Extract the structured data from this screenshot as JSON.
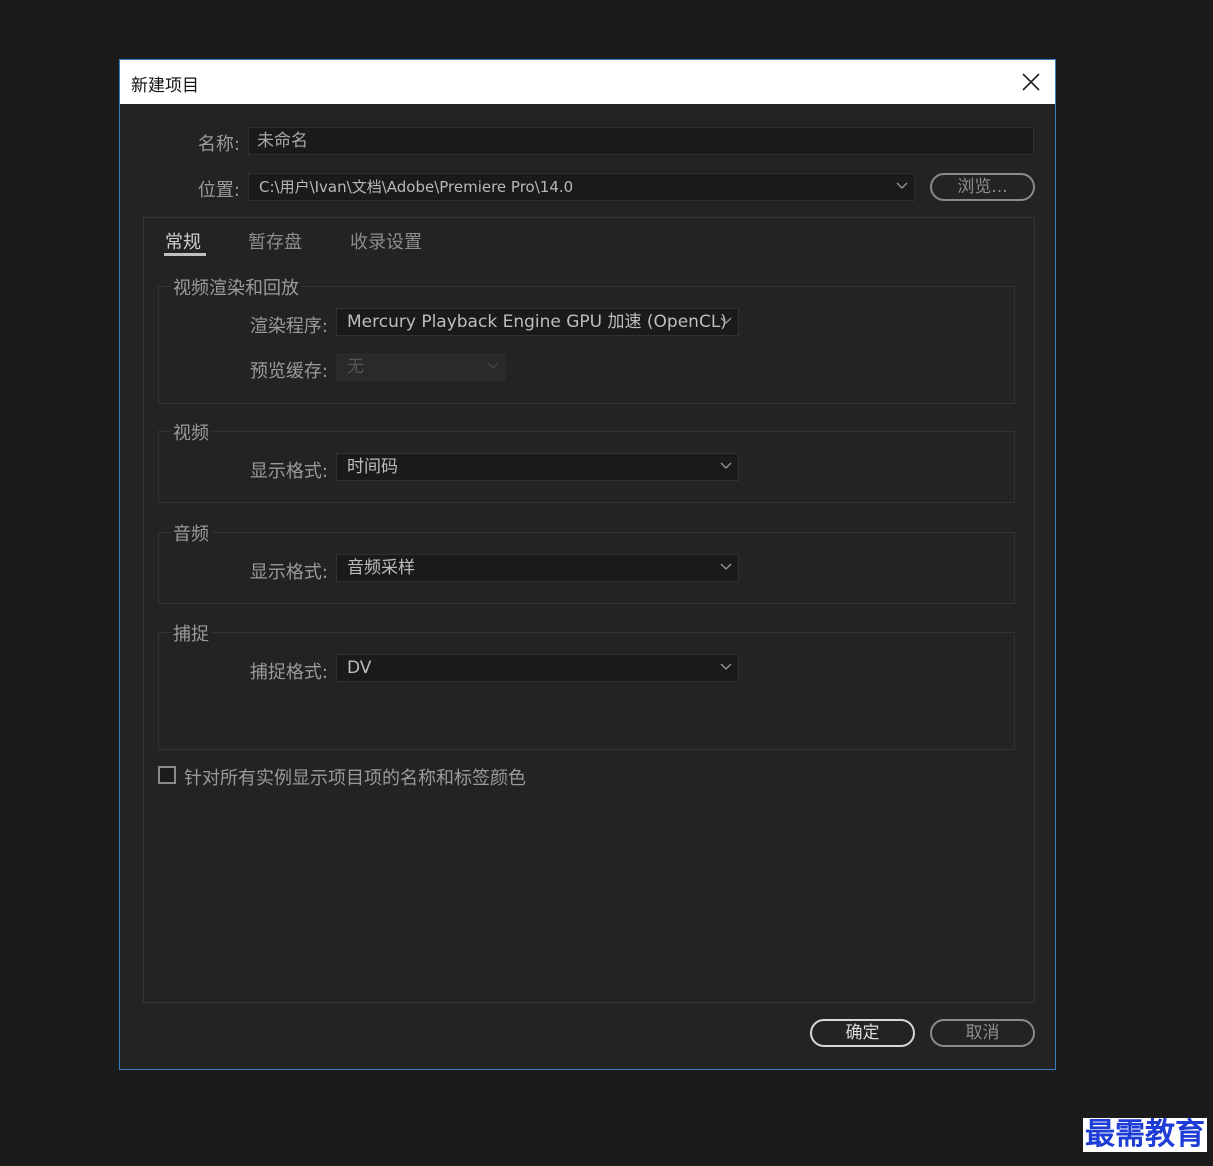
{
  "dialog": {
    "title": "新建项目",
    "close_icon": "close-icon",
    "name_label": "名称:",
    "name_value": "未命名",
    "location_label": "位置:",
    "location_value": "C:\\用户\\Ivan\\文档\\Adobe\\Premiere Pro\\14.0",
    "browse_label": "浏览..."
  },
  "tabs": [
    {
      "label": "常规",
      "active": true
    },
    {
      "label": "暂存盘",
      "active": false
    },
    {
      "label": "收录设置",
      "active": false
    }
  ],
  "groups": {
    "render": {
      "title": "视频渲染和回放",
      "renderer_label": "渲染程序:",
      "renderer_value": "Mercury Playback Engine GPU 加速 (OpenCL)",
      "preview_cache_label": "预览缓存:",
      "preview_cache_value": "无"
    },
    "video": {
      "title": "视频",
      "display_format_label": "显示格式:",
      "display_format_value": "时间码"
    },
    "audio": {
      "title": "音频",
      "display_format_label": "显示格式:",
      "display_format_value": "音频采样"
    },
    "capture": {
      "title": "捕捉",
      "capture_format_label": "捕捉格式:",
      "capture_format_value": "DV"
    }
  },
  "checkbox": {
    "label": "针对所有实例显示项目项的名称和标签颜色",
    "checked": false
  },
  "buttons": {
    "ok": "确定",
    "cancel": "取消"
  },
  "watermark": "最需教育",
  "colors": {
    "dialog_bg": "#232323",
    "border_accent": "#3a7fc4",
    "watermark": "#1e3cd6"
  }
}
